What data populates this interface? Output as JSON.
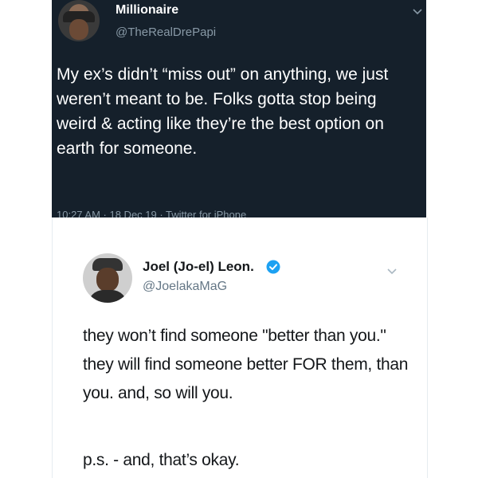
{
  "tweet_top": {
    "display_name": "Millionaire",
    "handle": "@TheRealDrePapi",
    "text": "My ex’s didn’t “miss out” on anything, we just weren’t meant to be.  Folks gotta stop being weird & acting like they’re the best option on earth for someone.",
    "meta": "10:27 AM · 18 Dec 19 · Twitter for iPhone",
    "avatar_icon": "profile-photo",
    "menu_icon": "chevron-down-icon",
    "colors": {
      "background": "#15202b",
      "text": "#ffffff",
      "secondary": "#8899a6"
    }
  },
  "tweet_bottom": {
    "display_name": "Joel (Jo-el) Leon.",
    "handle": "@JoelakaMaG",
    "verified_icon": "verified-badge-icon",
    "menu_icon": "chevron-down-icon",
    "text": "they won’t find someone \"better than you.\" they will find someone better FOR them, than you. and, so will you.",
    "ps": "p.s. - and, that’s okay.",
    "colors": {
      "background": "#ffffff",
      "text": "#14171a",
      "secondary": "#657786",
      "verified": "#1da1f2"
    }
  }
}
